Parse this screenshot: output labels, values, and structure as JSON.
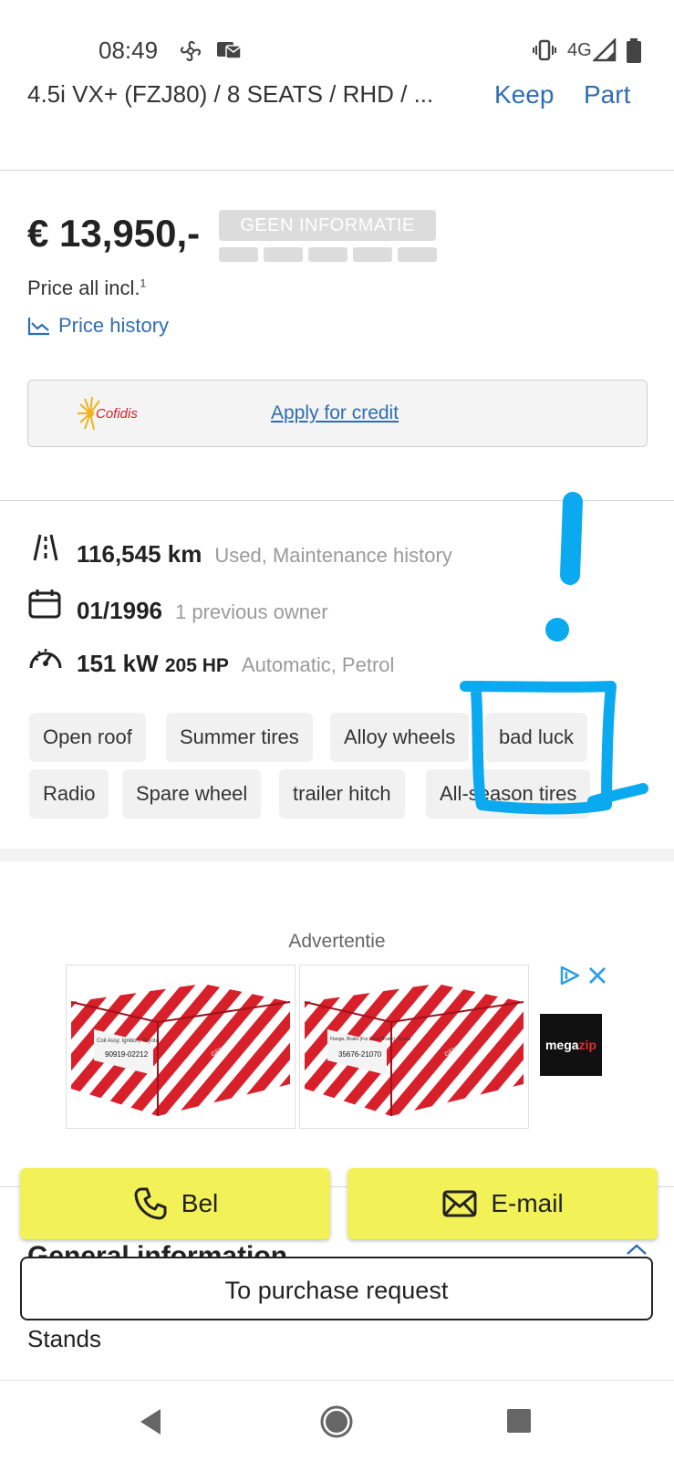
{
  "status_bar": {
    "time": "08:49",
    "network": "4G"
  },
  "header": {
    "title": "4.5i VX+ (FZJ80) / 8 SEATS / RHD / ...",
    "link_keep": "Keep",
    "link_part": "Part"
  },
  "price": {
    "amount": "€ 13,950,-",
    "badge": "GEEN INFORMATIE",
    "note": "Price all incl.",
    "note_sup": "1",
    "history_label": "Price history"
  },
  "credit": {
    "provider": "Cofidis",
    "link": "Apply for credit"
  },
  "specs": [
    {
      "main": "116,545 km",
      "sub": "Used, Maintenance history",
      "icon": "road-icon"
    },
    {
      "main": "01/1996",
      "sub": "1 previous owner",
      "icon": "calendar-icon"
    },
    {
      "main": "151 kW",
      "main_small": "205 HP",
      "sub": "Automatic, Petrol",
      "icon": "speedometer-icon"
    }
  ],
  "features": [
    "Open roof",
    "Summer tires",
    "Alloy wheels",
    "bad luck",
    "Radio",
    "Spare wheel",
    "trailer hitch",
    "All-season tires"
  ],
  "ad": {
    "label": "Advertentie",
    "brand_a": "mega",
    "brand_b": "zip",
    "product1": {
      "line1": "Coil Assy, Ignition, Toyota",
      "part": "90919-02212"
    },
    "product2": {
      "line1": "Flange, Brake (For Drive Brake), Toyota",
      "part": "35676-21070"
    },
    "box_text": "GENUINE"
  },
  "actions": {
    "call": "Bel",
    "email": "E-mail",
    "purchase": "To purchase request"
  },
  "section": {
    "general": "General information",
    "stands": "Stands"
  },
  "colors": {
    "accent_link": "#2f6db3",
    "action_yellow": "#f2f258",
    "annotation_blue": "#0aa9f0"
  }
}
